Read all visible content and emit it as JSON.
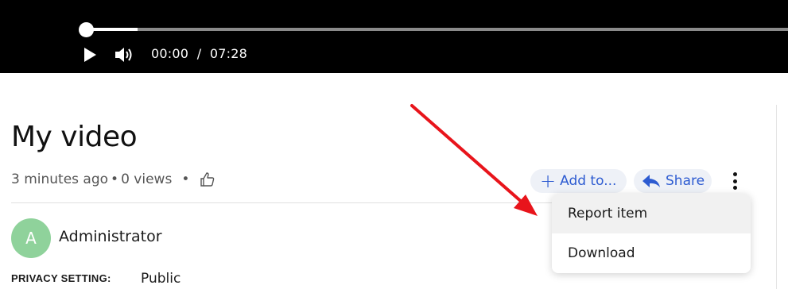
{
  "player": {
    "current_time": "00:00",
    "separator": "/",
    "duration": "07:28",
    "progress_fraction": 0.0,
    "buffered_fraction": 0.07
  },
  "video": {
    "title": "My video",
    "uploaded": "3 minutes ago",
    "views": "0 views",
    "dot": "•"
  },
  "actions": {
    "add_label": "Add to...",
    "add_icon": "+",
    "share_label": "Share"
  },
  "menu": {
    "items": [
      {
        "label": "Report item"
      },
      {
        "label": "Download"
      }
    ]
  },
  "author": {
    "initial": "A",
    "name": "Administrator"
  },
  "privacy": {
    "label": "PRIVACY SETTING:",
    "value": "Public"
  },
  "colors": {
    "accent": "#2d5bd1",
    "avatar": "#8fd29b",
    "annotation_arrow": "#e8141b"
  },
  "icons": {
    "play": "play-icon",
    "volume": "volume-icon",
    "like": "thumbs-up-icon",
    "share": "share-arrow-icon",
    "more": "vertical-dots-icon"
  }
}
